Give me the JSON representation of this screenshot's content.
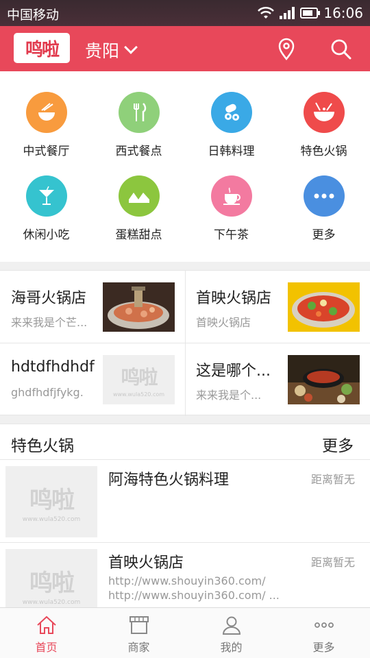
{
  "status_bar": {
    "carrier": "中国移动",
    "time": "16:06"
  },
  "header": {
    "logo_text": "鸣啦",
    "city": "贵阳"
  },
  "categories": [
    {
      "label": "中式餐厅",
      "color": "#f89b3e",
      "icon": "noodle-bowl-icon"
    },
    {
      "label": "西式餐点",
      "color": "#8fd07a",
      "icon": "fork-knife-icon"
    },
    {
      "label": "日韩料理",
      "color": "#3aa9e6",
      "icon": "sushi-icon"
    },
    {
      "label": "特色火锅",
      "color": "#ef4b4b",
      "icon": "hotpot-icon"
    },
    {
      "label": "休闲小吃",
      "color": "#35c3cf",
      "icon": "cocktail-icon"
    },
    {
      "label": "蛋糕甜点",
      "color": "#8cc63e",
      "icon": "cake-icon"
    },
    {
      "label": "下午茶",
      "color": "#f37aa0",
      "icon": "teacup-icon"
    },
    {
      "label": "更多",
      "color": "#4a8fe0",
      "icon": "more-dots-icon"
    }
  ],
  "shops": [
    {
      "name": "海哥火锅店",
      "desc": "来来我是个芒...",
      "image": "hotpot-photo"
    },
    {
      "name": "首映火锅店",
      "desc": "首映火锅店",
      "image": "hotpot-dish-photo"
    },
    {
      "name": "hdtdfhdhdf",
      "desc": "ghdfhdfjfykg.",
      "image": "placeholder-logo"
    },
    {
      "name": "这是哪个...",
      "desc": "来来我是个...",
      "image": "grill-photo"
    }
  ],
  "placeholder": {
    "logo": "鸣啦",
    "url": "www.wula520.com"
  },
  "section": {
    "title": "特色火锅",
    "more": "更多",
    "items": [
      {
        "title": "阿海特色火锅料理",
        "distance": "距离暂无",
        "urls": []
      },
      {
        "title": "首映火锅店",
        "distance": "距离暂无",
        "urls": [
          "http://www.shouyin360.com/",
          "http://www.shouyin360.com/ ..."
        ]
      }
    ]
  },
  "tabs": [
    {
      "label": "首页",
      "icon": "home-icon",
      "active": true
    },
    {
      "label": "商家",
      "icon": "store-icon",
      "active": false
    },
    {
      "label": "我的",
      "icon": "user-icon",
      "active": false
    },
    {
      "label": "更多",
      "icon": "more-dots-icon",
      "active": false
    }
  ],
  "colors": {
    "brand": "#e8485a",
    "text": "#222222",
    "muted": "#999999"
  }
}
